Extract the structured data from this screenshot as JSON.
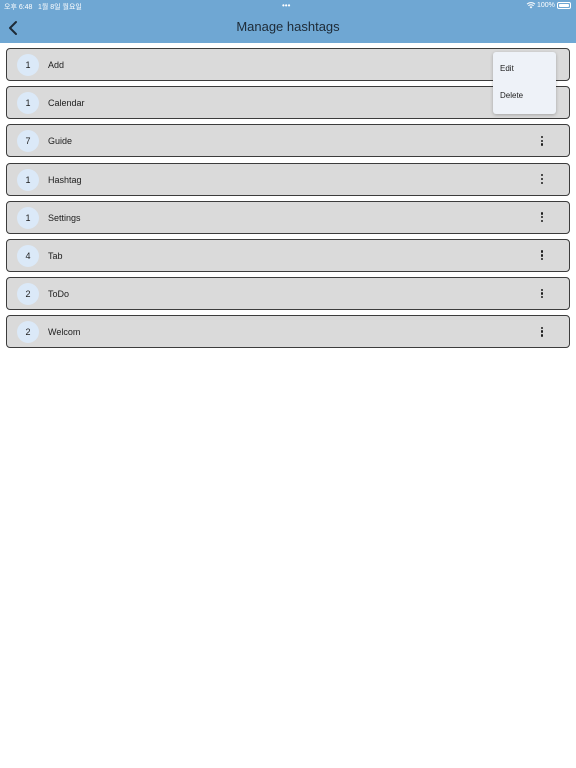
{
  "status": {
    "time": "오후 6:48",
    "date": "1월 8일 월요일",
    "dots": "•••",
    "battery": "100%"
  },
  "header": {
    "title": "Manage hashtags",
    "back_icon": "chevron-left-icon"
  },
  "hashtags": [
    {
      "count": "1",
      "label": "Add"
    },
    {
      "count": "1",
      "label": "Calendar"
    },
    {
      "count": "7",
      "label": "Guide"
    },
    {
      "count": "1",
      "label": "Hashtag"
    },
    {
      "count": "1",
      "label": "Settings"
    },
    {
      "count": "4",
      "label": "Tab"
    },
    {
      "count": "2",
      "label": "ToDo"
    },
    {
      "count": "2",
      "label": "Welcom"
    }
  ],
  "menu": {
    "edit_label": "Edit",
    "delete_label": "Delete"
  },
  "colors": {
    "header": "#6fa7d3",
    "row": "#dadada",
    "badge": "#dbe9f8",
    "menu": "#eef2f8"
  }
}
